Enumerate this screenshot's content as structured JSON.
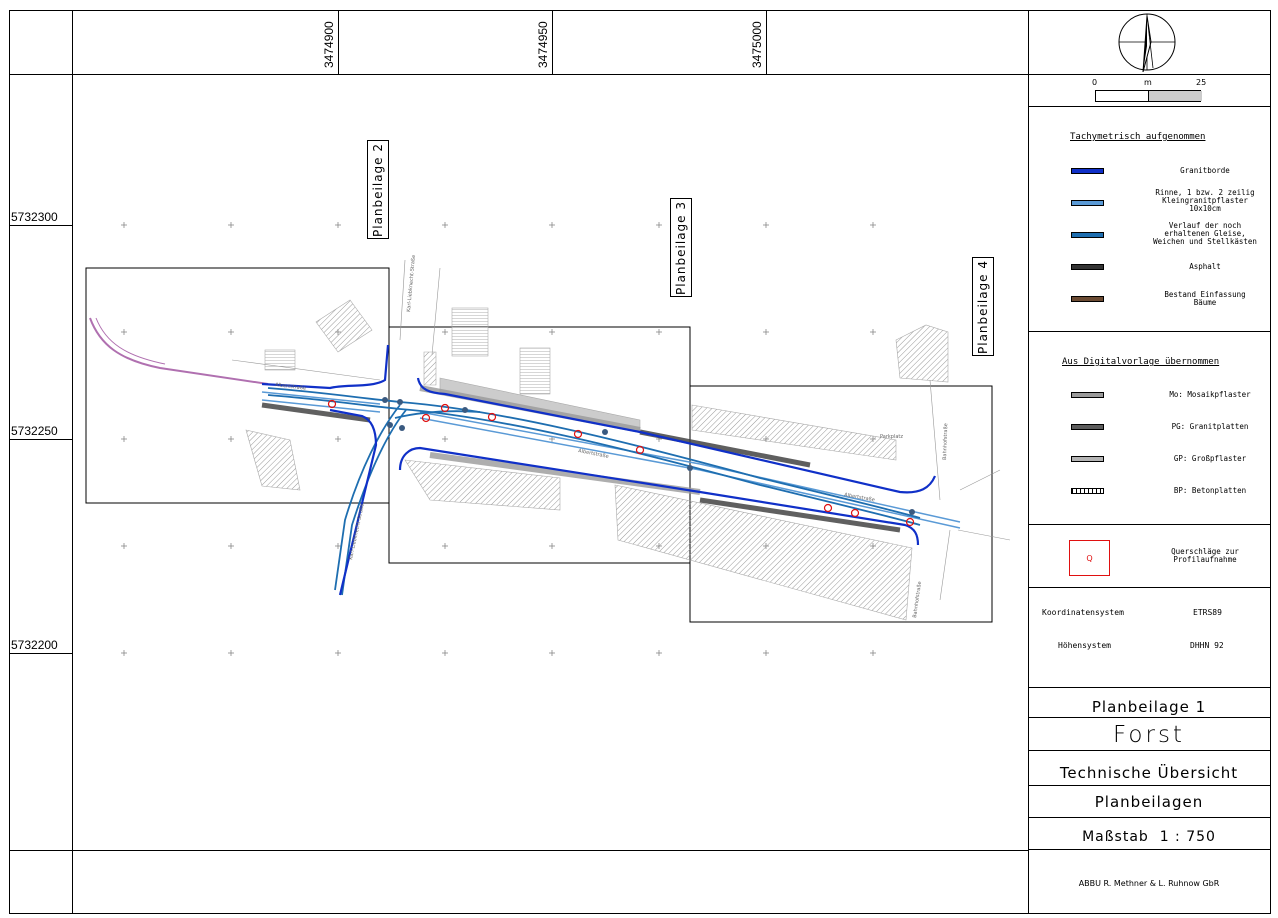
{
  "coordinates": {
    "easting": [
      "3474900",
      "3474950",
      "3475000"
    ],
    "northing": [
      "5732300",
      "5732250",
      "5732200"
    ]
  },
  "plan_sheets": [
    "Planbeilage 2",
    "Planbeilage 3",
    "Planbeilage 4"
  ],
  "street_names": {
    "albertstrasse_1": "Albertstraße",
    "albertstrasse_2": "Albertstraße",
    "albertstrasse_3": "Albertstraße",
    "liebknecht_north": "Karl-Liebknecht-Straße",
    "liebknecht_south": "Karl-Liebknecht-Straße",
    "bahnhofstrasse_north": "Bahnhofstraße",
    "bahnhofstrasse_south": "Bahnhofstraße",
    "parkplatz": "Parkplatz"
  },
  "scale_bar": {
    "start": "0",
    "unit": "m",
    "end": "25"
  },
  "legend_surveyed": {
    "title": "Tachymetrisch aufgenommen",
    "items": [
      {
        "label": "Granitborde",
        "color": "#1030c8"
      },
      {
        "label": "Rinne, 1 bzw. 2 zeilig\nKleingranitpflaster\n10x10cm",
        "color": "#5a9ad6"
      },
      {
        "label": "Verlauf der noch\nerhaltenen Gleise,\nWeichen und Stellkästen",
        "color": "#1e6eb0"
      },
      {
        "label": "Asphalt",
        "color": "#333333"
      },
      {
        "label": "Bestand Einfassung\nBäume",
        "color": "#6b4a32"
      }
    ]
  },
  "legend_digital": {
    "title": "Aus Digitalvorlage übernommen",
    "items": [
      {
        "label": "Mo: Mosaikpflaster",
        "color": "#9a9a9a"
      },
      {
        "label": "PG: Granitplatten",
        "color": "#5c5c5c"
      },
      {
        "label": "GP: Großpflaster",
        "color": "#b4b4b4"
      },
      {
        "label": "BP: Betonplatten",
        "color": "#ffffff"
      }
    ]
  },
  "cross_section": {
    "symbol": "Q",
    "label": "Querschläge zur\nProfilaufnahme",
    "color": "#e01010"
  },
  "systems": {
    "coord_label": "Koordinatensystem",
    "coord_value": "ETRS89",
    "height_label": "Höhensystem",
    "height_value": "DHHN 92"
  },
  "title_block": {
    "sheet": "Planbeilage 1",
    "place": "Forst",
    "subject": "Technische Übersicht",
    "content": "Planbeilagen",
    "scale": "Maßstab  1 : 750",
    "office": "ABBU R. Methner & L. Ruhnow GbR"
  }
}
